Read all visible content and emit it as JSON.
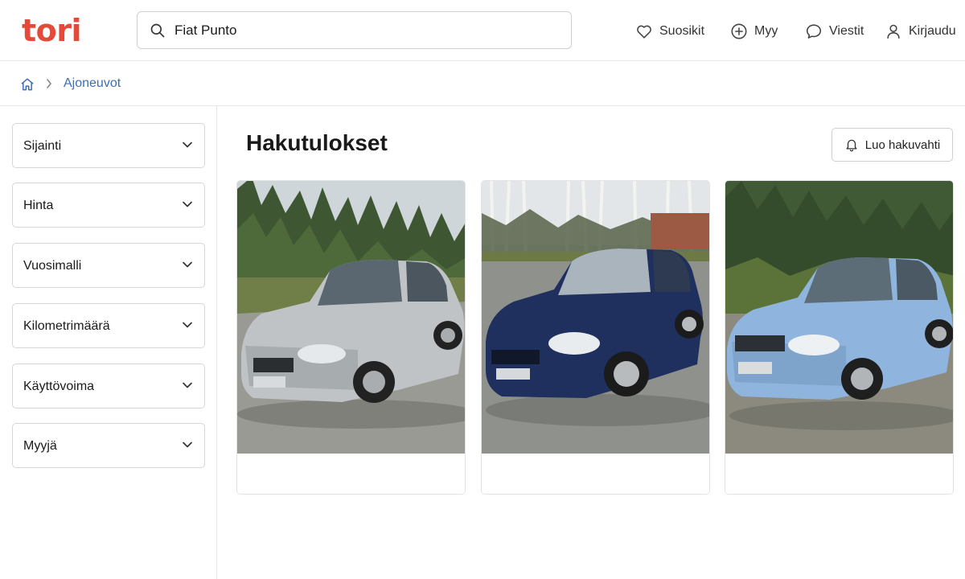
{
  "header": {
    "logo": "tori",
    "logo_color": "#e5493a",
    "search": {
      "value": "Fiat Punto",
      "icon": "search-icon"
    },
    "nav": [
      {
        "label": "Suosikit",
        "icon": "heart-icon"
      },
      {
        "label": "Myy",
        "icon": "plus-circle-icon"
      },
      {
        "label": "Viestit",
        "icon": "chat-bubble-icon"
      },
      {
        "label": "Kirjaudu",
        "icon": "user-icon"
      }
    ]
  },
  "breadcrumb": {
    "home_icon": "home-icon",
    "separator_icon": "chevron-right-icon",
    "link": "Ajoneuvot",
    "link_color": "#3a6fb5"
  },
  "filters": [
    "Sijainti",
    "Hinta",
    "Vuosimalli",
    "Kilometrimäärä",
    "Käyttövoima",
    "Myyjä"
  ],
  "main": {
    "title": "Hakutulokset",
    "alert_button": {
      "label": "Luo hakuvahti",
      "icon": "bell-icon"
    }
  },
  "listings": [
    {
      "car_color": "#bfc3c6"
    },
    {
      "car_color": "#1f2f5e"
    },
    {
      "car_color": "#8fb4dd"
    }
  ]
}
